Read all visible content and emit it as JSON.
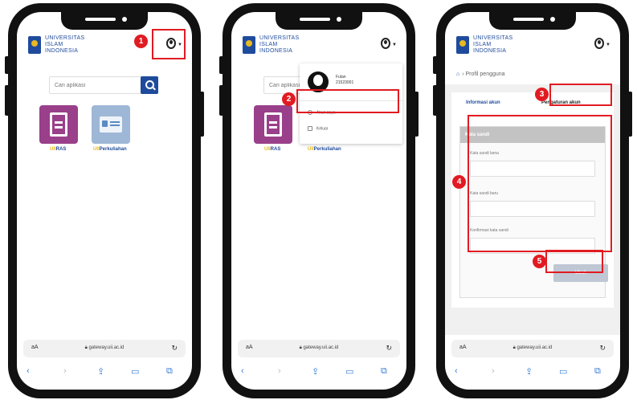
{
  "header": {
    "univ_line1": "UNIVERSITAS",
    "univ_line2": "ISLAM",
    "univ_line3": "INDONESIA"
  },
  "home": {
    "search_placeholder": "Cari aplikasi",
    "apps": [
      {
        "prefix": "UII",
        "name": "RAS"
      },
      {
        "prefix": "UII",
        "name": "Perkuliahan"
      }
    ]
  },
  "menu": {
    "user_name": "Fulan",
    "user_id": "21523001",
    "account_label": "Akun saya",
    "logout_label": "Keluar"
  },
  "profile": {
    "breadcrumb": "Profil pengguna",
    "tab_info": "Informasi akun",
    "tab_settings": "Pengaturan akun",
    "panel_title": "Kata sandi",
    "old_password_label": "Kata sandi lama",
    "new_password_label": "Kata sandi baru",
    "confirm_password_label": "Konfirmasi kata sandi",
    "submit_label": "Ubah"
  },
  "browser": {
    "aa": "aA",
    "url": "gateway.uii.ac.id"
  },
  "steps": [
    "1",
    "2",
    "3",
    "4",
    "5"
  ],
  "colors": {
    "brand": "#1f4b9c",
    "accent": "#e8b923",
    "highlight": "#e11b22"
  }
}
